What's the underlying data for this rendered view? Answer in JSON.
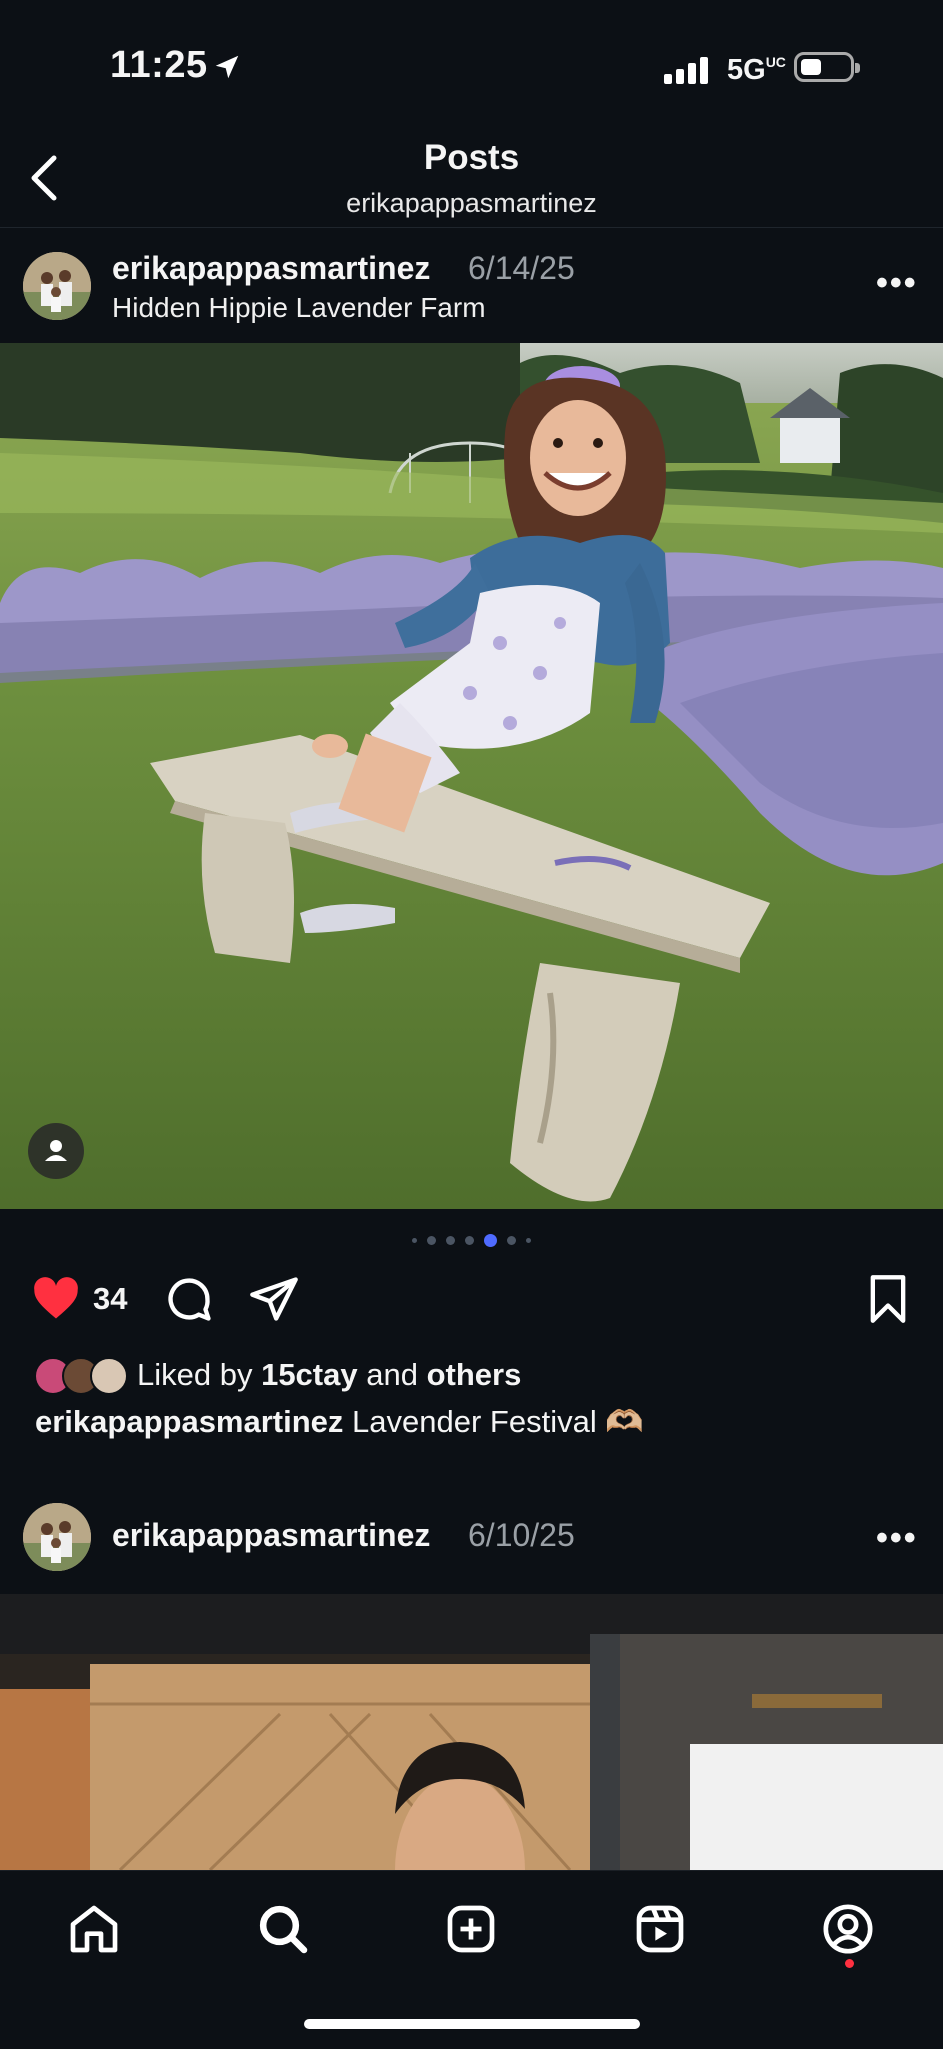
{
  "status_bar": {
    "time": "11:25",
    "network": "5G",
    "network_suffix": "UC"
  },
  "header": {
    "title": "Posts",
    "subtitle": "erikapappasmartinez"
  },
  "posts": [
    {
      "username": "erikapappasmartinez",
      "date": "6/14/25",
      "location": "Hidden Hippie Lavender Farm",
      "likes": "34",
      "liked_by_prefix": "Liked by ",
      "liked_by_user": "15ctay",
      "liked_by_mid": " and ",
      "liked_by_others": "others",
      "caption_user": "erikapappasmartinez",
      "caption_text": " Lavender Festival 🫶🏼",
      "carousel_count": 7,
      "carousel_active": 4
    },
    {
      "username": "erikapappasmartinez",
      "date": "6/10/25"
    }
  ],
  "more_label": "•••",
  "colors": {
    "background": "#0c1015",
    "like_red": "#ff3040",
    "carousel_active": "#4f6bff"
  },
  "icons": [
    "location-arrow-icon",
    "back-chevron-icon",
    "more-icon",
    "tag-people-icon",
    "heart-icon",
    "comment-icon",
    "share-icon",
    "bookmark-icon",
    "home-icon",
    "search-icon",
    "create-icon",
    "reels-icon",
    "profile-icon"
  ]
}
